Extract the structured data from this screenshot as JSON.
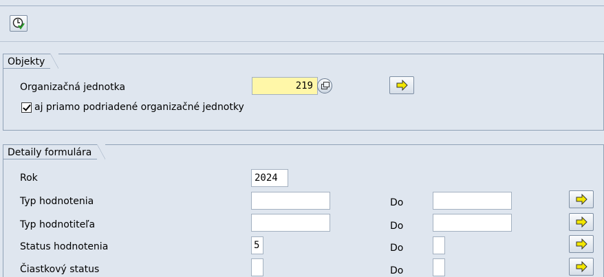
{
  "toolbar": {
    "execute_icon": "execute-clock-icon"
  },
  "objekty": {
    "title": "Objekty",
    "org_unit_label": "Organizačná jednotka",
    "org_unit_value": "219",
    "include_sub_label": "aj priamo podriadené organizačné jednotky",
    "include_sub_checked": true
  },
  "detaily": {
    "title": "Detaily formulára",
    "rows": [
      {
        "label": "Rok",
        "value": "2024",
        "to_label": "",
        "to_value": ""
      },
      {
        "label": "Typ hodnotenia",
        "value": "",
        "to_label": "Do",
        "to_value": ""
      },
      {
        "label": "Typ hodnotiteľa",
        "value": "",
        "to_label": "Do",
        "to_value": ""
      },
      {
        "label": "Status hodnotenia",
        "value": "5",
        "to_label": "Do",
        "to_value": ""
      },
      {
        "label": "Čiastkový status",
        "value": "",
        "to_label": "Do",
        "to_value": ""
      }
    ]
  },
  "colors": {
    "background": "#dfe6ef",
    "required_field": "#fff7a8",
    "arrow": "#f2e600"
  }
}
